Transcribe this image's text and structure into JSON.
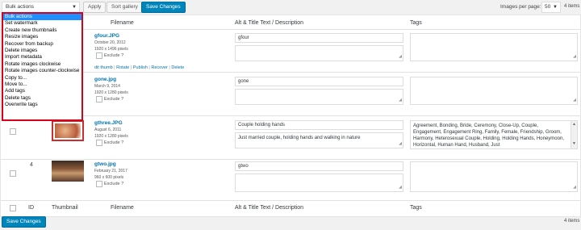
{
  "toolbar_top": {
    "bulk_selected": "Bulk actions",
    "apply": "Apply",
    "sort_gallery": "Sort gallery",
    "save_changes": "Save Changes",
    "images_per_page_label": "Images per page:",
    "images_per_page_value": "50",
    "item_count": "4 items"
  },
  "bulk_menu": [
    "Bulk actions",
    "Set watermark",
    "Create new thumbnails",
    "Resize images",
    "Recover from backup",
    "Delete images",
    "Import metadata",
    "Rotate images clockwise",
    "Rotate images counter-clockwise",
    "Copy to...",
    "Move to...",
    "Add tags",
    "Delete tags",
    "Overwrite tags"
  ],
  "columns": {
    "id": "ID",
    "thumbnail": "Thumbnail",
    "filename": "Filename",
    "alt_desc": "Alt & Title Text / Description",
    "tags": "Tags"
  },
  "rows": [
    {
      "filename": "gfour.JPG",
      "date": "October 20, 2012",
      "size": "1920 x 1496 pixels",
      "exclude": "Exclude ?",
      "alt": "gfour",
      "description": "",
      "tags": ""
    },
    {
      "filename": "gone.jpg",
      "date": "March 9, 2014",
      "size": "1920 x 1280 pixels",
      "exclude": "Exclude ?",
      "alt": "gone",
      "description": "",
      "tags": ""
    },
    {
      "filename": "gthree.JPG",
      "date": "August 6, 2011",
      "size": "1920 x 1280 pixels",
      "exclude": "Exclude ?",
      "alt": "Couple holding hands",
      "description": "Just married couple, holding hands and walking in nature",
      "tags": "Agreement, Bonding, Bride, Ceremony, Close-Up, Couple, Engagement, Engagement Ring, Family, Female, Friendship, Groom, Harmony, Heterosexual Couple, Holding, Holding Hands, Honeymoon, Horizontal, Human Hand, Husband, Just"
    },
    {
      "id": "4",
      "filename": "gtwo.jpg",
      "date": "February 21, 2017",
      "size": "960 x 600 pixels",
      "exclude": "Exclude ?",
      "alt": "gtwo",
      "description": "",
      "tags": ""
    }
  ],
  "row_actions": {
    "edit_thumb": "dit thumb",
    "sep": "|",
    "rotate": "Rotate",
    "publish": "Publish",
    "recover": "Recover",
    "delete": "Delete"
  },
  "toolbar_bottom": {
    "save_changes": "Save Changes",
    "item_count": "4 items"
  }
}
